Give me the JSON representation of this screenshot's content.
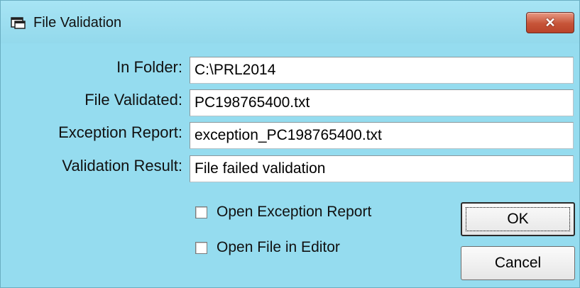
{
  "window": {
    "title": "File Validation",
    "close_glyph": "✕"
  },
  "fields": [
    {
      "label": "In Folder:",
      "value": "C:\\PRL2014"
    },
    {
      "label": "File Validated:",
      "value": "PC198765400.txt"
    },
    {
      "label": "Exception Report:",
      "value": "exception_PC198765400.txt"
    },
    {
      "label": "Validation Result:",
      "value": "File failed validation"
    }
  ],
  "checkboxes": [
    {
      "label": "Open Exception Report",
      "checked": false
    },
    {
      "label": "Open File in Editor",
      "checked": false
    }
  ],
  "buttons": {
    "ok": "OK",
    "cancel": "Cancel"
  },
  "colors": {
    "window_bg": "#95dcef",
    "close_button": "#c65438"
  },
  "icons": {
    "title": "window-app-icon",
    "close": "close-icon"
  }
}
